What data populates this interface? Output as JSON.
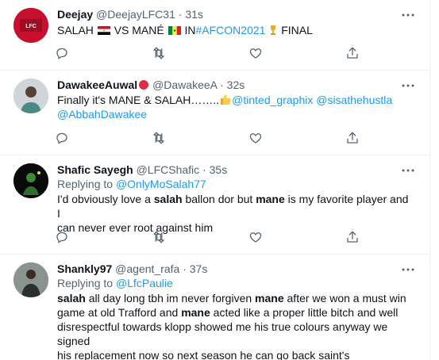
{
  "tweets": [
    {
      "name": "Deejay",
      "handle": "@DeejayLFC31",
      "sep": "·",
      "time": "31s",
      "text_a": "SALAH",
      "text_b": "VS MANÉ",
      "text_c": "IN",
      "hashtag": "#AFCON2021",
      "text_d": "FINAL"
    },
    {
      "name": "DawakeeAuwal",
      "handle": "@DawakeeA",
      "sep": "·",
      "time": "32s",
      "text_a": "Finally it's MANE & SALAH……..",
      "mention1": "@tinted_graphix",
      "mention2": "@sisathehustla",
      "mention3": "@AbbahDawakee"
    },
    {
      "name": "Shafic Sayegh",
      "handle": "@LFCShafic",
      "sep": "·",
      "time": "35s",
      "replying_label": "Replying to",
      "replying_to": "@OnlyMoSalah77",
      "t1": "I'd obviously love a ",
      "t2": "salah",
      "t3": " ballon dor but ",
      "t4": "mane",
      "t5": " is my favorite player and I",
      "t6": "can never ever root against him"
    },
    {
      "name": "Shankly97",
      "handle": "@agent_rafa",
      "sep": "·",
      "time": "37s",
      "replying_label": "Replying to",
      "replying_to": "@LfcPaulie",
      "t1": "salah",
      "t2": " all day long tbh im never forgiven ",
      "t3": "mane",
      "t4": " after we won a must win",
      "t5": "game at old Trafford and ",
      "t6": "mane",
      "t7": " acted like a proper little bitch and well",
      "t8": "disrespectful towards klopp showed me his true colours anyway we signed",
      "t9": "his replacement now so next season he can go back saint's"
    }
  ],
  "icons": [
    "more-icon",
    "reply-icon",
    "retweet-icon",
    "like-icon",
    "share-icon"
  ],
  "colors": {
    "link": "#1d9bf0",
    "meta": "#536471",
    "text": "#0f1419",
    "divider": "#eff3f4"
  }
}
